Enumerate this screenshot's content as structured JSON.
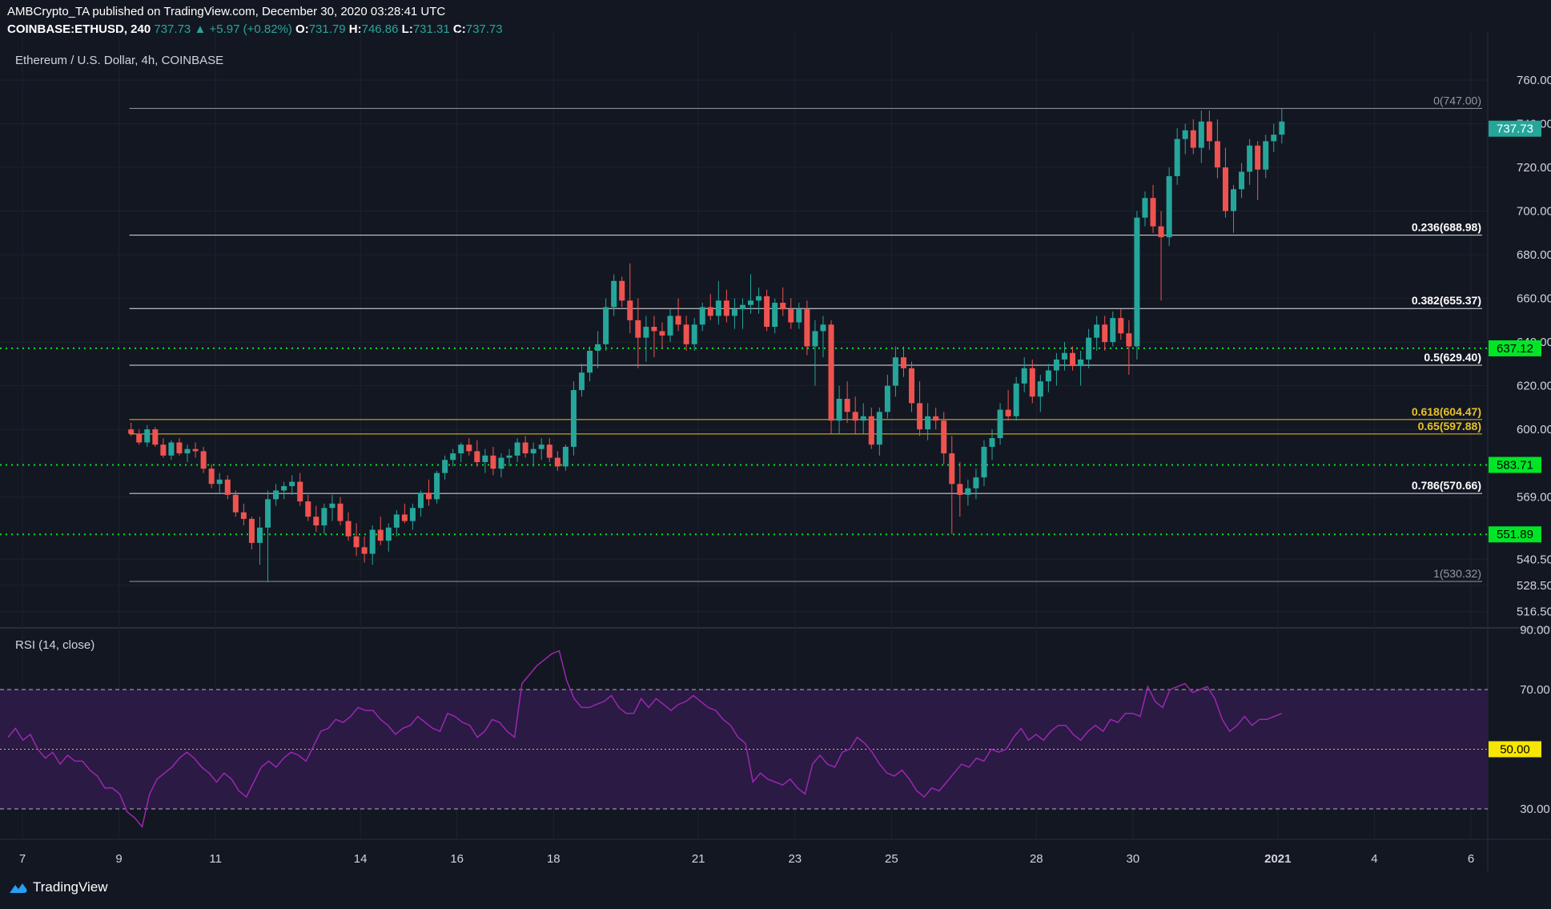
{
  "header": {
    "line1": "AMBCrypto_TA published on TradingView.com, December 30, 2020 03:28:41 UTC",
    "symbol": "COINBASE:ETHUSD, 240",
    "last": "737.73",
    "change": "+5.97 (+0.82%)",
    "o_label": "O:",
    "o": "731.79",
    "h_label": "H:",
    "h": "746.86",
    "l_label": "L:",
    "l": "731.31",
    "c_label": "C:",
    "c": "737.73"
  },
  "main_title": "Ethereum / U.S. Dollar, 4h, COINBASE",
  "rsi_title": "RSI (14, close)",
  "brand": "TradingView",
  "colors": {
    "background": "#131722",
    "up": "#26a69a",
    "down": "#ef5350",
    "support": "#00e626",
    "fib_gold": "#e6c229",
    "rsi_line": "#9c27b0",
    "rsi_band": "#2a1a44"
  },
  "chart_data": [
    {
      "type": "candlestick",
      "title": "Ethereum / U.S. Dollar, 4h, COINBASE",
      "y_ticks": [
        "760.00",
        "740.00",
        "720.00",
        "700.00",
        "680.00",
        "660.00",
        "640.00",
        "620.00",
        "600.00",
        "583.71",
        "569.00",
        "551.89",
        "540.50",
        "528.50",
        "516.50"
      ],
      "x_ticks": [
        "7",
        "9",
        "11",
        "14",
        "16",
        "18",
        "21",
        "23",
        "25",
        "28",
        "30",
        "2021",
        "4",
        "6"
      ],
      "last_price_label": "737.73",
      "fib_levels": [
        {
          "ratio": "0",
          "price": 747.0,
          "label": "0(747.00)"
        },
        {
          "ratio": "0.236",
          "price": 688.98,
          "label": "0.236(688.98)"
        },
        {
          "ratio": "0.382",
          "price": 655.37,
          "label": "0.382(655.37)"
        },
        {
          "ratio": "0.5",
          "price": 629.4,
          "label": "0.5(629.40)"
        },
        {
          "ratio": "0.618",
          "price": 604.47,
          "label": "0.618(604.47)"
        },
        {
          "ratio": "0.65",
          "price": 597.88,
          "label": "0.65(597.88)"
        },
        {
          "ratio": "0.786",
          "price": 570.66,
          "label": "0.786(570.66)"
        },
        {
          "ratio": "1",
          "price": 530.32,
          "label": "1(530.32)"
        }
      ],
      "support_lines": [
        {
          "price": 637.12,
          "label": "637.12"
        },
        {
          "price": 583.71,
          "label": "583.71"
        },
        {
          "price": 551.89,
          "label": "551.89"
        }
      ],
      "candles": [
        [
          600,
          603,
          597,
          598
        ],
        [
          598,
          600,
          593,
          594
        ],
        [
          594,
          602,
          592,
          600
        ],
        [
          600,
          601,
          592,
          593
        ],
        [
          593,
          596,
          587,
          588
        ],
        [
          588,
          595,
          586,
          594
        ],
        [
          594,
          596,
          588,
          589
        ],
        [
          589,
          593,
          585,
          591
        ],
        [
          591,
          594,
          587,
          590
        ],
        [
          590,
          592,
          580,
          582
        ],
        [
          582,
          584,
          573,
          575
        ],
        [
          575,
          580,
          571,
          577
        ],
        [
          577,
          579,
          568,
          570
        ],
        [
          570,
          572,
          560,
          562
        ],
        [
          562,
          566,
          556,
          559
        ],
        [
          559,
          560,
          545,
          548
        ],
        [
          548,
          560,
          538,
          555
        ],
        [
          555,
          572,
          530,
          568
        ],
        [
          568,
          575,
          565,
          572
        ],
        [
          572,
          576,
          568,
          574
        ],
        [
          574,
          579,
          570,
          576
        ],
        [
          576,
          580,
          565,
          567
        ],
        [
          567,
          570,
          558,
          560
        ],
        [
          560,
          565,
          553,
          556
        ],
        [
          556,
          566,
          552,
          564
        ],
        [
          564,
          570,
          558,
          566
        ],
        [
          566,
          569,
          556,
          558
        ],
        [
          558,
          562,
          549,
          551
        ],
        [
          551,
          557,
          542,
          546
        ],
        [
          546,
          551,
          539,
          543
        ],
        [
          543,
          556,
          538,
          554
        ],
        [
          554,
          560,
          547,
          549
        ],
        [
          549,
          557,
          544,
          555
        ],
        [
          555,
          563,
          551,
          561
        ],
        [
          561,
          566,
          557,
          558
        ],
        [
          558,
          566,
          554,
          564
        ],
        [
          564,
          572,
          560,
          571
        ],
        [
          571,
          577,
          565,
          568
        ],
        [
          568,
          581,
          566,
          580
        ],
        [
          580,
          588,
          577,
          586
        ],
        [
          586,
          591,
          583,
          589
        ],
        [
          589,
          594,
          585,
          593
        ],
        [
          593,
          596,
          588,
          590
        ],
        [
          590,
          595,
          583,
          585
        ],
        [
          585,
          591,
          580,
          588
        ],
        [
          588,
          592,
          579,
          582
        ],
        [
          582,
          589,
          578,
          587
        ],
        [
          587,
          591,
          583,
          588
        ],
        [
          588,
          596,
          585,
          594
        ],
        [
          594,
          597,
          587,
          589
        ],
        [
          589,
          594,
          583,
          591
        ],
        [
          591,
          596,
          586,
          593
        ],
        [
          593,
          596,
          585,
          587
        ],
        [
          587,
          590,
          581,
          583
        ],
        [
          583,
          593,
          581,
          592
        ],
        [
          592,
          622,
          588,
          618
        ],
        [
          618,
          630,
          615,
          626
        ],
        [
          626,
          638,
          622,
          636
        ],
        [
          636,
          645,
          628,
          639
        ],
        [
          639,
          660,
          636,
          656
        ],
        [
          656,
          671,
          652,
          668
        ],
        [
          668,
          670,
          656,
          659
        ],
        [
          659,
          676,
          644,
          650
        ],
        [
          650,
          660,
          628,
          642
        ],
        [
          642,
          652,
          631,
          647
        ],
        [
          647,
          652,
          633,
          645
        ],
        [
          645,
          649,
          637,
          643
        ],
        [
          643,
          655,
          640,
          652
        ],
        [
          652,
          660,
          645,
          648
        ],
        [
          648,
          652,
          636,
          639
        ],
        [
          639,
          651,
          636,
          648
        ],
        [
          648,
          658,
          645,
          656
        ],
        [
          656,
          662,
          650,
          652
        ],
        [
          652,
          668,
          648,
          659
        ],
        [
          659,
          664,
          649,
          652
        ],
        [
          652,
          660,
          646,
          655
        ],
        [
          655,
          660,
          646,
          657
        ],
        [
          657,
          671,
          653,
          659
        ],
        [
          659,
          665,
          653,
          661
        ],
        [
          661,
          664,
          645,
          647
        ],
        [
          647,
          660,
          644,
          658
        ],
        [
          658,
          665,
          652,
          655
        ],
        [
          655,
          660,
          646,
          649
        ],
        [
          649,
          658,
          646,
          655
        ],
        [
          655,
          659,
          634,
          638
        ],
        [
          638,
          650,
          620,
          645
        ],
        [
          645,
          652,
          633,
          648
        ],
        [
          648,
          650,
          598,
          604
        ],
        [
          604,
          620,
          598,
          614
        ],
        [
          614,
          622,
          603,
          608
        ],
        [
          608,
          615,
          598,
          604
        ],
        [
          604,
          612,
          598,
          606
        ],
        [
          606,
          610,
          591,
          593
        ],
        [
          593,
          610,
          588,
          608
        ],
        [
          608,
          625,
          605,
          620
        ],
        [
          620,
          638,
          615,
          633
        ],
        [
          633,
          638,
          624,
          628
        ],
        [
          628,
          631,
          608,
          612
        ],
        [
          612,
          622,
          597,
          600
        ],
        [
          600,
          612,
          595,
          606
        ],
        [
          606,
          610,
          600,
          604
        ],
        [
          604,
          608,
          584,
          589
        ],
        [
          589,
          597,
          552,
          575
        ],
        [
          575,
          585,
          560,
          570
        ],
        [
          570,
          577,
          565,
          573
        ],
        [
          573,
          582,
          568,
          578
        ],
        [
          578,
          595,
          574,
          592
        ],
        [
          592,
          600,
          586,
          596
        ],
        [
          596,
          612,
          593,
          609
        ],
        [
          609,
          618,
          604,
          606
        ],
        [
          606,
          624,
          604,
          621
        ],
        [
          621,
          633,
          617,
          628
        ],
        [
          628,
          632,
          612,
          615
        ],
        [
          615,
          625,
          608,
          622
        ],
        [
          622,
          630,
          617,
          627
        ],
        [
          627,
          635,
          620,
          632
        ],
        [
          632,
          640,
          627,
          635
        ],
        [
          635,
          638,
          627,
          629
        ],
        [
          629,
          636,
          620,
          632
        ],
        [
          632,
          646,
          628,
          642
        ],
        [
          642,
          652,
          636,
          648
        ],
        [
          648,
          652,
          636,
          640
        ],
        [
          640,
          654,
          638,
          651
        ],
        [
          651,
          655,
          641,
          644
        ],
        [
          644,
          650,
          625,
          638
        ],
        [
          638,
          700,
          632,
          697
        ],
        [
          697,
          709,
          693,
          706
        ],
        [
          706,
          712,
          690,
          693
        ],
        [
          693,
          700,
          659,
          688
        ],
        [
          688,
          720,
          684,
          716
        ],
        [
          716,
          738,
          712,
          733
        ],
        [
          733,
          740,
          726,
          737
        ],
        [
          737,
          742,
          726,
          729
        ],
        [
          729,
          746,
          722,
          741
        ],
        [
          741,
          746,
          728,
          732
        ],
        [
          732,
          742,
          715,
          720
        ],
        [
          720,
          729,
          697,
          700
        ],
        [
          700,
          712,
          690,
          710
        ],
        [
          710,
          722,
          706,
          718
        ],
        [
          718,
          733,
          712,
          730
        ],
        [
          730,
          732,
          705,
          719
        ],
        [
          719,
          735,
          715,
          732
        ],
        [
          732,
          740,
          727,
          735
        ],
        [
          735,
          747,
          731,
          741
        ]
      ]
    },
    {
      "type": "line",
      "title": "RSI (14, close)",
      "y_ticks": [
        "90.00",
        "70.00",
        "50.00",
        "30.00"
      ],
      "levels": [
        70,
        50,
        30
      ],
      "level_50_label": "50.00",
      "values": [
        54,
        57,
        53,
        55,
        50,
        47,
        49,
        45,
        48,
        46,
        46,
        43,
        41,
        37,
        37,
        35,
        29,
        27,
        24,
        35,
        40,
        42,
        44,
        47,
        49,
        47,
        44,
        42,
        39,
        42,
        40,
        36,
        34,
        39,
        44,
        46,
        44,
        47,
        49,
        48,
        46,
        51,
        56,
        57,
        60,
        59,
        61,
        64,
        63,
        63,
        60,
        58,
        55,
        57,
        58,
        61,
        59,
        57,
        56,
        62,
        61,
        59,
        58,
        54,
        56,
        60,
        59,
        56,
        54,
        72,
        75,
        78,
        80,
        82,
        83,
        73,
        67,
        64,
        64,
        65,
        66,
        68,
        64,
        62,
        62,
        67,
        64,
        67,
        65,
        63,
        65,
        66,
        68,
        66,
        64,
        63,
        60,
        58,
        54,
        52,
        39,
        42,
        40,
        39,
        38,
        40,
        37,
        35,
        45,
        48,
        45,
        44,
        49,
        50,
        54,
        52,
        49,
        45,
        42,
        41,
        43,
        40,
        36,
        34,
        37,
        36,
        39,
        42,
        45,
        44,
        47,
        46,
        50,
        49,
        50,
        54,
        57,
        53,
        55,
        53,
        56,
        58,
        58,
        55,
        53,
        56,
        58,
        56,
        60,
        59,
        62,
        62,
        61,
        71,
        66,
        64,
        70,
        71,
        72,
        69,
        70,
        71,
        67,
        60,
        56,
        58,
        61,
        58,
        60,
        60,
        61,
        62
      ]
    }
  ]
}
